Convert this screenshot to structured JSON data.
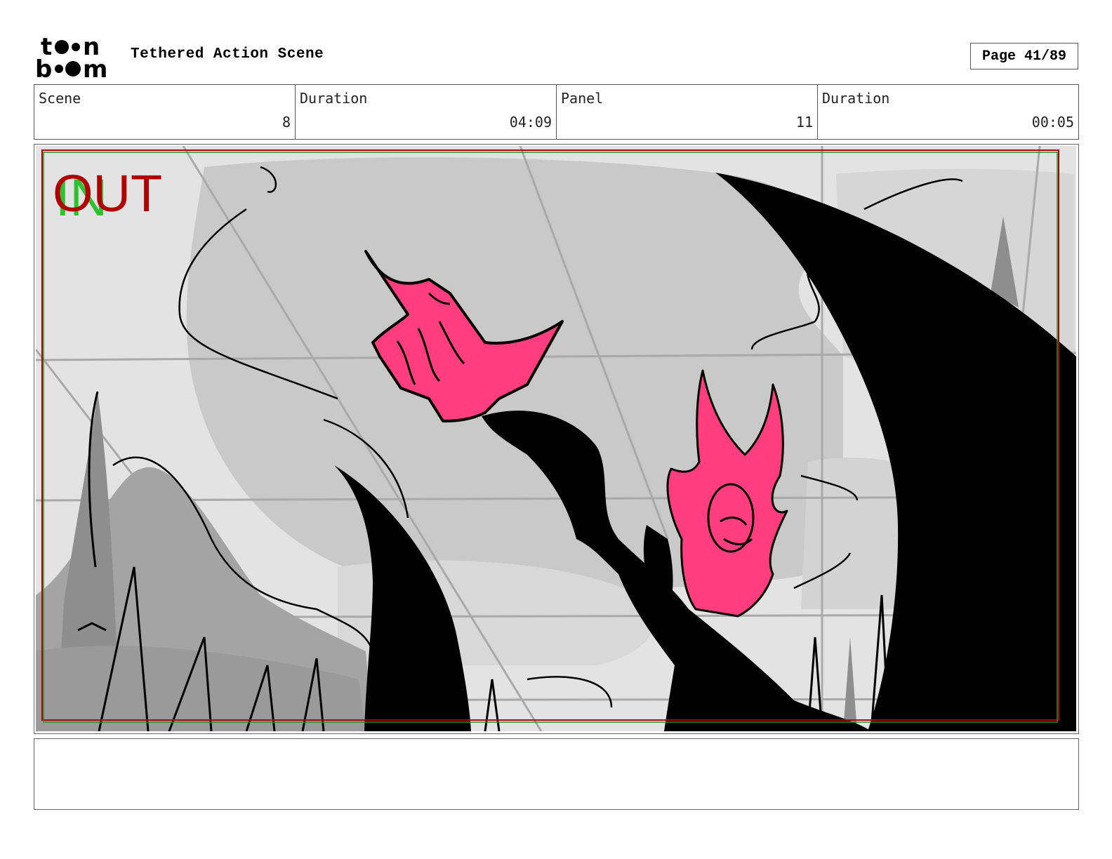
{
  "brand": {
    "logo_name": "toon boom",
    "logo_line1": "toon",
    "logo_line2": "boom"
  },
  "header": {
    "title": "Tethered Action Scene",
    "page_label": "Page 41/89"
  },
  "info": {
    "scene_label": "Scene",
    "scene_value": "8",
    "scene_duration_label": "Duration",
    "scene_duration_value": "04:09",
    "panel_label": "Panel",
    "panel_value": "11",
    "panel_duration_label": "Duration",
    "panel_duration_value": "00:05"
  },
  "panel": {
    "in_marker": "IN",
    "out_marker": "OUT"
  },
  "colors": {
    "accent_pink": "#ff3d7f",
    "silhouette": "#000000",
    "in_green": "#2ec02e",
    "out_red": "#b00000"
  },
  "notes": {
    "text": ""
  }
}
